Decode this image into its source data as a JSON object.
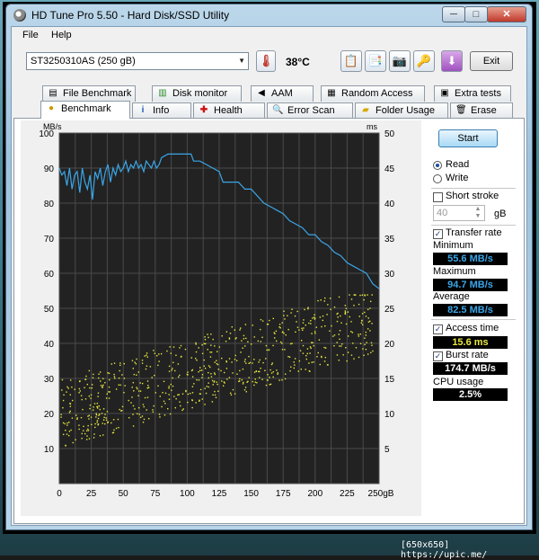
{
  "window": {
    "title": "HD Tune Pro 5.50 - Hard Disk/SSD Utility",
    "controls": {
      "minimize": "─",
      "maximize": "□",
      "close": "✕"
    }
  },
  "menu": {
    "file": "File",
    "help": "Help"
  },
  "toolbar": {
    "drive": "ST3250310AS (250 gB)",
    "temperature": "38°C",
    "exit_label": "Exit",
    "icons": [
      "copy-info-icon",
      "copy-screen-icon",
      "screenshot-icon",
      "options-icon",
      "download-icon"
    ]
  },
  "tabs_top": [
    {
      "label": "File Benchmark",
      "icon": "file-benchmark-icon"
    },
    {
      "label": "Disk monitor",
      "icon": "disk-monitor-icon"
    },
    {
      "label": "AAM",
      "icon": "speaker-icon"
    },
    {
      "label": "Random Access",
      "icon": "random-access-icon"
    },
    {
      "label": "Extra tests",
      "icon": "extra-tests-icon"
    }
  ],
  "tabs_bottom": [
    {
      "label": "Benchmark",
      "icon": "benchmark-icon",
      "active": true
    },
    {
      "label": "Info",
      "icon": "info-icon"
    },
    {
      "label": "Health",
      "icon": "health-icon"
    },
    {
      "label": "Error Scan",
      "icon": "error-scan-icon"
    },
    {
      "label": "Folder Usage",
      "icon": "folder-icon"
    },
    {
      "label": "Erase",
      "icon": "erase-icon"
    }
  ],
  "side": {
    "start_label": "Start",
    "read_label": "Read",
    "write_label": "Write",
    "mode": "Read",
    "short_stroke_label": "Short stroke",
    "short_stroke_checked": false,
    "short_stroke_value": "40",
    "short_stroke_unit": "gB",
    "transfer_rate_label": "Transfer rate",
    "transfer_rate_checked": true,
    "minimum_label": "Minimum",
    "minimum_value": "55.6 MB/s",
    "maximum_label": "Maximum",
    "maximum_value": "94.7 MB/s",
    "average_label": "Average",
    "average_value": "82.5 MB/s",
    "access_time_label": "Access time",
    "access_time_checked": true,
    "access_time_value": "15.6 ms",
    "burst_rate_label": "Burst rate",
    "burst_rate_checked": true,
    "burst_rate_value": "174.7 MB/s",
    "cpu_label": "CPU usage",
    "cpu_value": "2.5%",
    "colors": {
      "transfer": "#3aa6e8",
      "access": "#e8e840",
      "burst": "#ffffff",
      "cpu": "#ffffff"
    }
  },
  "chart_data": {
    "type": "line",
    "left_unit": "MB/s",
    "right_unit": "ms",
    "x_unit_label": "250gB",
    "xlim": [
      0,
      250
    ],
    "ylim_left": [
      0,
      100
    ],
    "ylim_right": [
      0,
      50
    ],
    "x_ticks": [
      0,
      25,
      50,
      75,
      100,
      125,
      150,
      175,
      200,
      225
    ],
    "y_ticks_left": [
      10,
      20,
      30,
      40,
      50,
      60,
      70,
      80,
      90,
      100
    ],
    "y_ticks_right": [
      5,
      10,
      15,
      20,
      25,
      30,
      35,
      40,
      45,
      50
    ],
    "background": "#222222",
    "grid": true,
    "series": [
      {
        "name": "Transfer rate",
        "color": "#3aa6e8",
        "x": [
          0,
          2,
          4,
          6,
          8,
          10,
          12,
          14,
          16,
          18,
          20,
          22,
          24,
          26,
          28,
          30,
          32,
          34,
          36,
          38,
          40,
          42,
          44,
          46,
          48,
          50,
          52,
          54,
          56,
          58,
          60,
          62,
          64,
          66,
          68,
          70,
          72,
          74,
          76,
          78,
          80,
          85,
          90,
          95,
          100,
          103,
          105,
          110,
          115,
          120,
          125,
          128,
          130,
          135,
          140,
          145,
          150,
          155,
          160,
          165,
          170,
          175,
          180,
          185,
          190,
          195,
          200,
          205,
          210,
          215,
          220,
          225,
          230,
          235,
          240,
          245,
          250
        ],
        "values": [
          90,
          88,
          89,
          85,
          90,
          84,
          88,
          89,
          83,
          90,
          86,
          84,
          88,
          81,
          89,
          87,
          90,
          85,
          89,
          91,
          86,
          90,
          88,
          91,
          89,
          90,
          92,
          89,
          91,
          90,
          92,
          90,
          91,
          89,
          92,
          91,
          90,
          92,
          90,
          91,
          93,
          94,
          94,
          94,
          94,
          94,
          92,
          92,
          91,
          90,
          89,
          86,
          86,
          86,
          86,
          84,
          84,
          82,
          80,
          79,
          78,
          77,
          75,
          74,
          73,
          71,
          71,
          69,
          68,
          66,
          65,
          63,
          62,
          61,
          60,
          57,
          55.6
        ]
      },
      {
        "name": "Access time",
        "color": "#e8e840",
        "type": "scatter",
        "axis": "right",
        "note": "scattered access times, roughly 10 ms near the start rising to about 25 ms at the end"
      }
    ]
  }
}
